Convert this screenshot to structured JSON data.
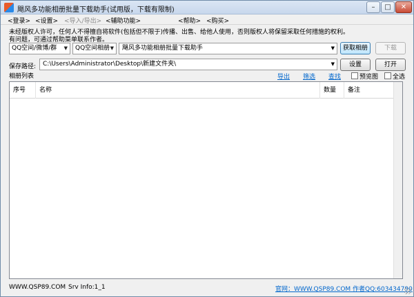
{
  "window": {
    "title": "飓风多功能相册批量下载助手(试用版，下载有限制)",
    "controls": {
      "minimize": "–",
      "maximize": "□",
      "close": "✕"
    }
  },
  "menu": [
    {
      "label": "<登录>",
      "disabled": false
    },
    {
      "label": "<设置>",
      "disabled": false
    },
    {
      "label": "<导入/导出>",
      "disabled": true
    },
    {
      "label": "<辅助功能>",
      "disabled": false
    },
    {
      "label": "<帮助>",
      "disabled": false
    },
    {
      "label": "<购买>",
      "disabled": false
    }
  ],
  "notice": {
    "line1": "未经版权人许可，任何人不得擅自将软件(包括但不限于)传播、出售、给他人使用，否则版权人将保留采取任何措施的权利。",
    "line2": "有问题，可通过帮助菜单联系作者。"
  },
  "source": {
    "type_select": "QQ空间/微博/群",
    "album_select": "QQ空间相册",
    "url_input": "飓风多功能相册批量下载助手",
    "fetch_button": "获取相册",
    "download_button": "下载"
  },
  "save_path": {
    "label": "保存路径:",
    "value": "C:\\Users\\Administrator\\Desktop\\新建文件夹\\",
    "settings_button": "设置",
    "open_button": "打开"
  },
  "album_list": {
    "label": "相册列表",
    "export_link": "导出",
    "filter_link": "筛选",
    "search_link": "查找",
    "preview_checkbox": "预览图",
    "select_all_checkbox": "全选"
  },
  "table": {
    "columns": [
      "序号",
      "名称",
      "数量",
      "备注"
    ],
    "rows": []
  },
  "statusbar": {
    "site": "WWW.QSP89.COM",
    "srv_info": "Srv Info:1_1",
    "official": "官网：WWW.QSP89.COM 作者QQ:603434790"
  }
}
